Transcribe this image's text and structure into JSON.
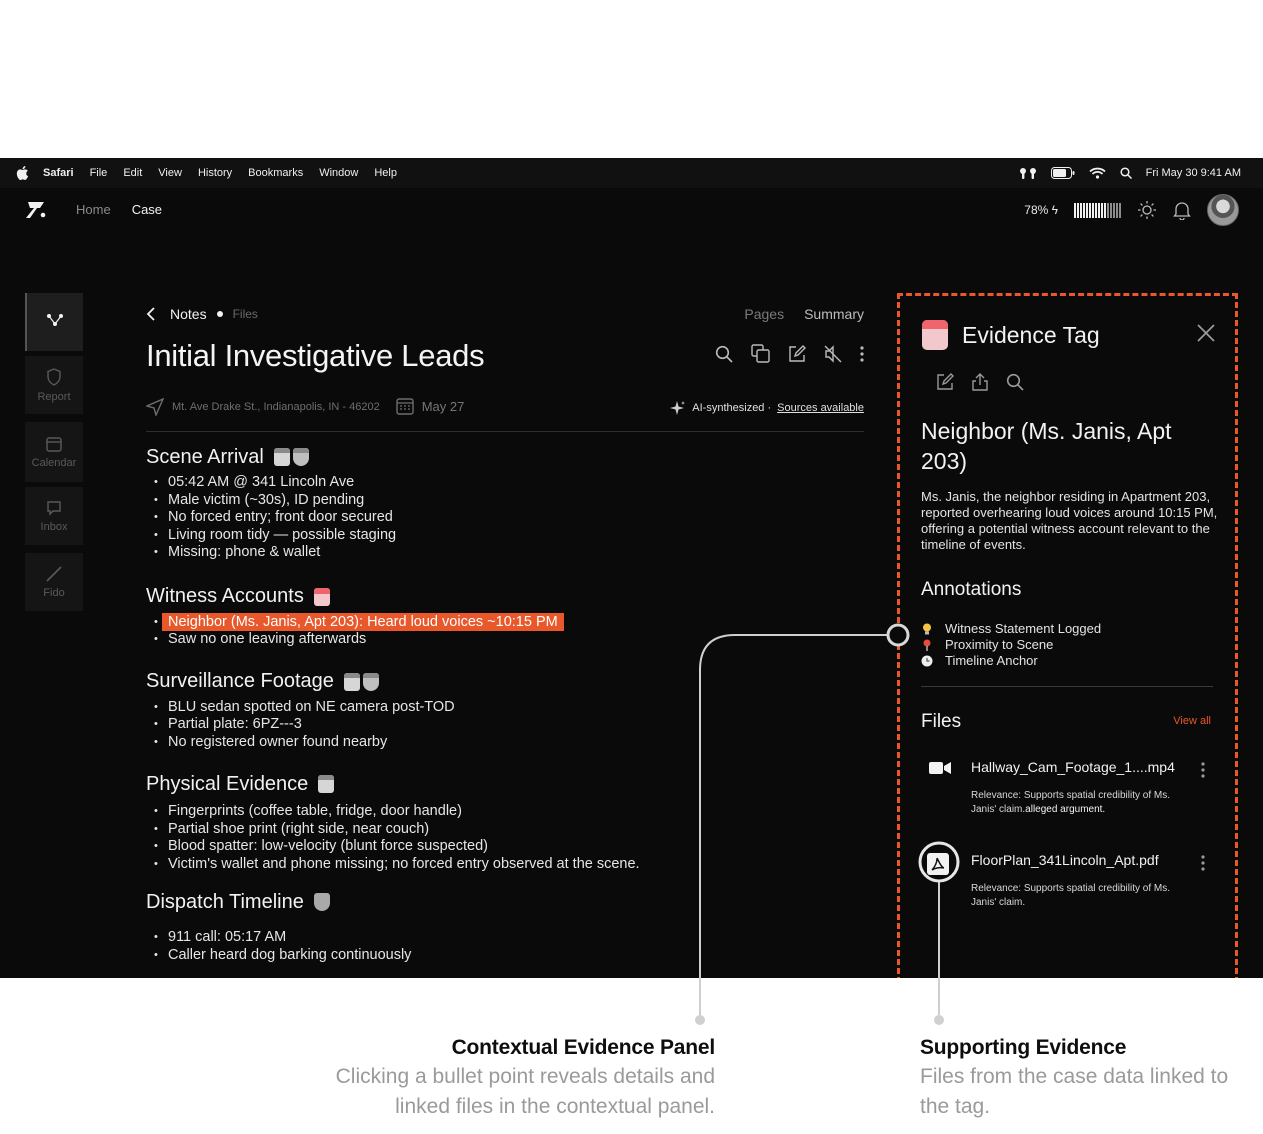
{
  "menubar": {
    "app": "Safari",
    "items": [
      "File",
      "Edit",
      "View",
      "History",
      "Bookmarks",
      "Window",
      "Help"
    ],
    "clock": "Fri May 30  9:41 AM"
  },
  "header": {
    "nav_home": "Home",
    "nav_case": "Case",
    "battery": "78%"
  },
  "sidebar": {
    "items": [
      {
        "label": "",
        "icon": "graph-icon"
      },
      {
        "label": "Report",
        "icon": "shield-icon"
      },
      {
        "label": "Calendar",
        "icon": "calendar-icon"
      },
      {
        "label": "Inbox",
        "icon": "chat-icon"
      },
      {
        "label": "Fido",
        "icon": "pen-icon"
      }
    ]
  },
  "notes": {
    "breadcrumb_notes": "Notes",
    "breadcrumb_files": "Files",
    "tab_pages": "Pages",
    "tab_summary": "Summary",
    "title": "Initial Investigative Leads",
    "location": "Mt. Ave Drake St., Indianapolis, IN - 46202",
    "date": "May  27",
    "ai_label": "AI-synthesized ·",
    "sources_link": "Sources available",
    "sections": [
      {
        "heading": "Scene Arrival",
        "bullets": [
          "05:42 AM @ 341 Lincoln Ave",
          "Male victim (~30s), ID pending",
          "No forced entry; front door secured",
          "Living room tidy — possible staging",
          "Missing: phone & wallet"
        ]
      },
      {
        "heading": "Witness Accounts",
        "bullets": [
          "Neighbor (Ms. Janis, Apt 203): Heard loud voices ~10:15 PM",
          "Saw no one leaving afterwards"
        ]
      },
      {
        "heading": "Surveillance Footage",
        "bullets": [
          "BLU sedan spotted on NE camera post-TOD",
          "Partial plate: 6PZ---3",
          "No registered owner found nearby"
        ]
      },
      {
        "heading": "Physical Evidence",
        "bullets": [
          "Fingerprints (coffee table, fridge, door handle)",
          "Partial shoe print (right side, near couch)",
          "Blood spatter: low-velocity (blunt force suspected)",
          "Victim's wallet and phone missing; no forced entry observed at the scene."
        ]
      },
      {
        "heading": "Dispatch Timeline",
        "bullets": [
          "911 call: 05:17 AM",
          "Caller heard dog barking continuously"
        ]
      }
    ]
  },
  "panel": {
    "title": "Evidence Tag",
    "subject": "Neighbor (Ms. Janis, Apt 203)",
    "description": "Ms. Janis, the neighbor residing in Apartment 203, reported overhearing loud voices around 10:15 PM, offering a potential witness account relevant to the timeline of events.",
    "annotations_title": "Annotations",
    "annotations": [
      "Witness Statement Logged",
      "Proximity to Scene",
      "Timeline Anchor"
    ],
    "files_title": "Files",
    "view_all": "View all",
    "files": [
      {
        "name": "Hallway_Cam_Footage_1....mp4",
        "relevance_label": "Relevance: ",
        "relevance": "Supports spatial credibility of Ms. Janis' claim.",
        "relevance_tail": "alleged argument."
      },
      {
        "name": "FloorPlan_341Lincoln_Apt.pdf",
        "relevance_label": "Relevance: ",
        "relevance": "Supports spatial credibility of Ms. Janis' claim.",
        "relevance_tail": ""
      }
    ]
  },
  "captions": {
    "left_title": "Contextual Evidence Panel",
    "left_sub": "Clicking a bullet point reveals details and linked files in the contextual panel.",
    "right_title": "Supporting Evidence",
    "right_sub": "Files from the case data linked to the tag."
  },
  "colors": {
    "accent": "#e8582a",
    "tag_pink": "#f0646e"
  }
}
